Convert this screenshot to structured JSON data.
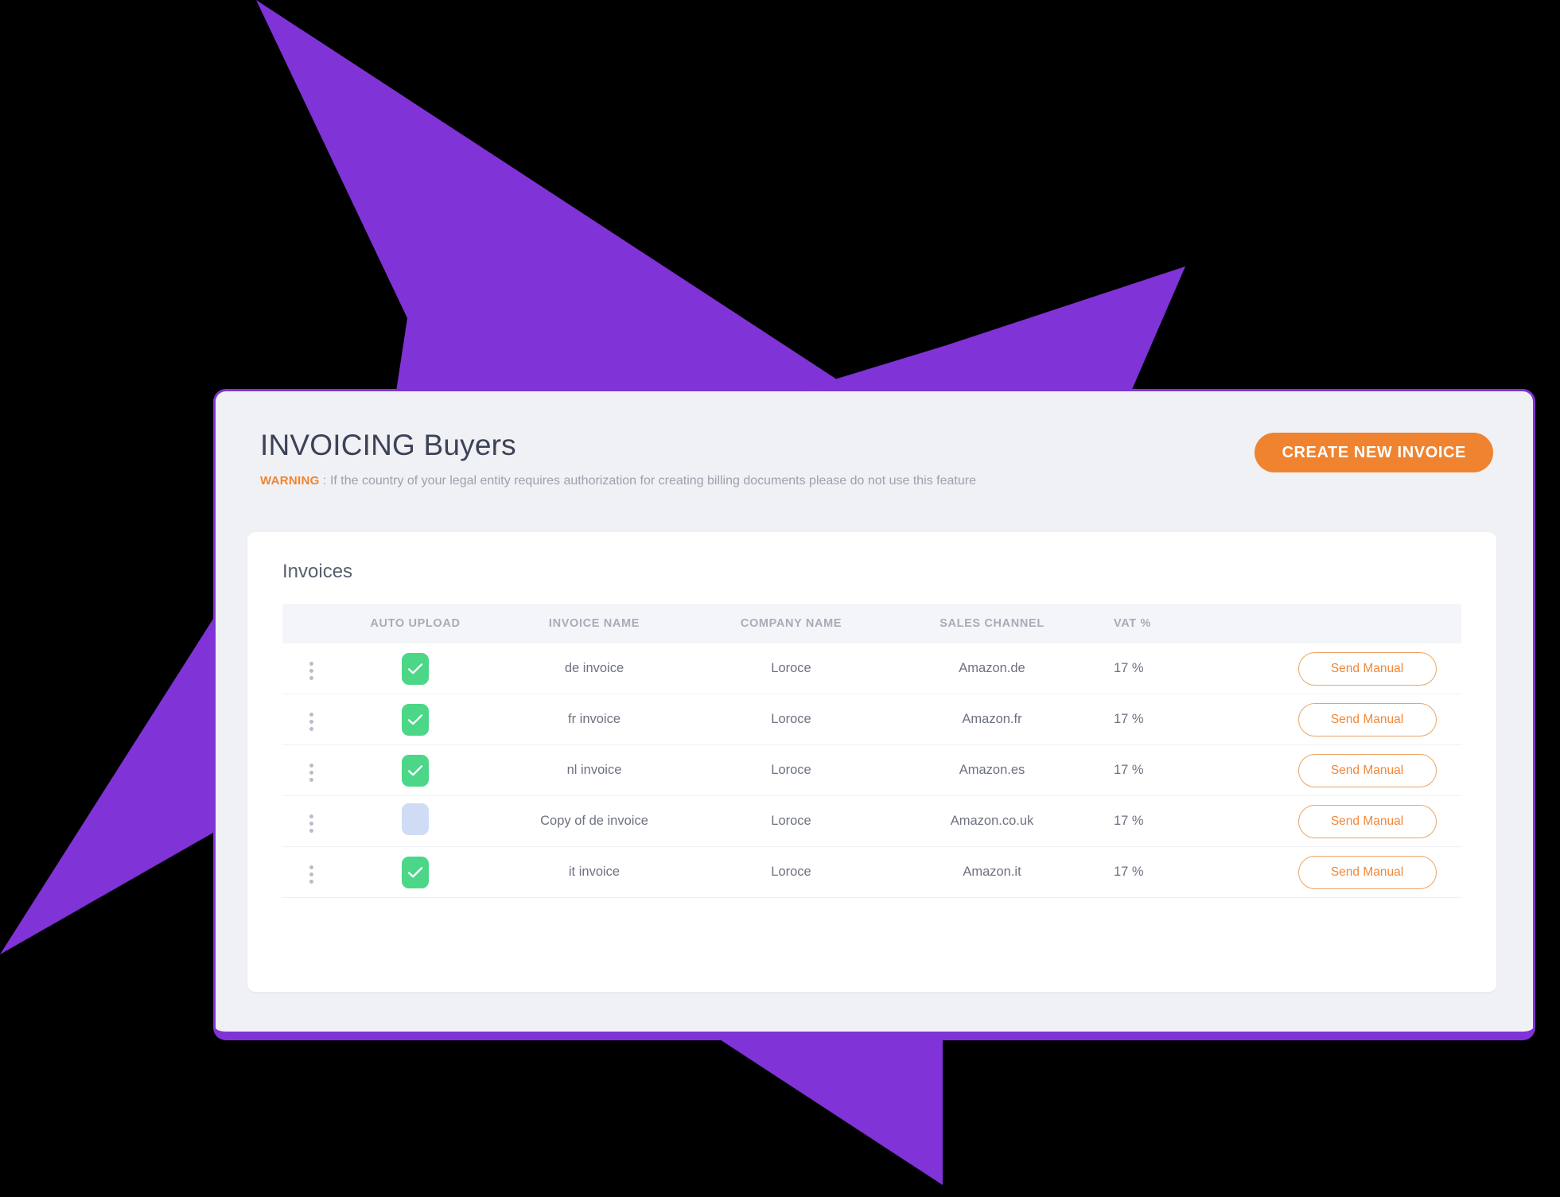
{
  "theme": {
    "accent_purple": "#8033d6",
    "accent_orange": "#ef8330",
    "checkbox_on": "#4bd787",
    "checkbox_off": "#cfdcf5",
    "panel_bg": "#f0f1f5",
    "card_bg": "#ffffff",
    "header_row_bg": "#f4f5f8",
    "backdrop": "#000000"
  },
  "header": {
    "title": "INVOICING Buyers",
    "warning_label": "WARNING",
    "warning_separator": " : ",
    "warning_text": "If the country of your legal entity requires authorization for creating billing documents please do not use this feature",
    "create_button_label": "CREATE NEW INVOICE"
  },
  "card": {
    "title": "Invoices",
    "columns": [
      {
        "key": "kebab",
        "label": ""
      },
      {
        "key": "auto",
        "label": "AUTO UPLOAD"
      },
      {
        "key": "name",
        "label": "INVOICE NAME"
      },
      {
        "key": "company",
        "label": "COMPANY NAME"
      },
      {
        "key": "channel",
        "label": "SALES CHANNEL"
      },
      {
        "key": "vat",
        "label": "VAT %"
      },
      {
        "key": "action",
        "label": ""
      }
    ],
    "rows": [
      {
        "auto_upload": true,
        "invoice_name": "de invoice",
        "company_name": "Loroce",
        "sales_channel": "Amazon.de",
        "vat": "17 %",
        "action_label": "Send Manual"
      },
      {
        "auto_upload": true,
        "invoice_name": "fr invoice",
        "company_name": "Loroce",
        "sales_channel": "Amazon.fr",
        "vat": "17 %",
        "action_label": "Send Manual"
      },
      {
        "auto_upload": true,
        "invoice_name": "nl invoice",
        "company_name": "Loroce",
        "sales_channel": "Amazon.es",
        "vat": "17 %",
        "action_label": "Send Manual"
      },
      {
        "auto_upload": false,
        "invoice_name": "Copy of de invoice",
        "company_name": "Loroce",
        "sales_channel": "Amazon.co.uk",
        "vat": "17 %",
        "action_label": "Send Manual"
      },
      {
        "auto_upload": true,
        "invoice_name": "it invoice",
        "company_name": "Loroce",
        "sales_channel": "Amazon.it",
        "vat": "17 %",
        "action_label": "Send Manual"
      }
    ],
    "row_menu_icon": "kebab-menu-icon",
    "checkbox_on_icon": "check-icon"
  }
}
